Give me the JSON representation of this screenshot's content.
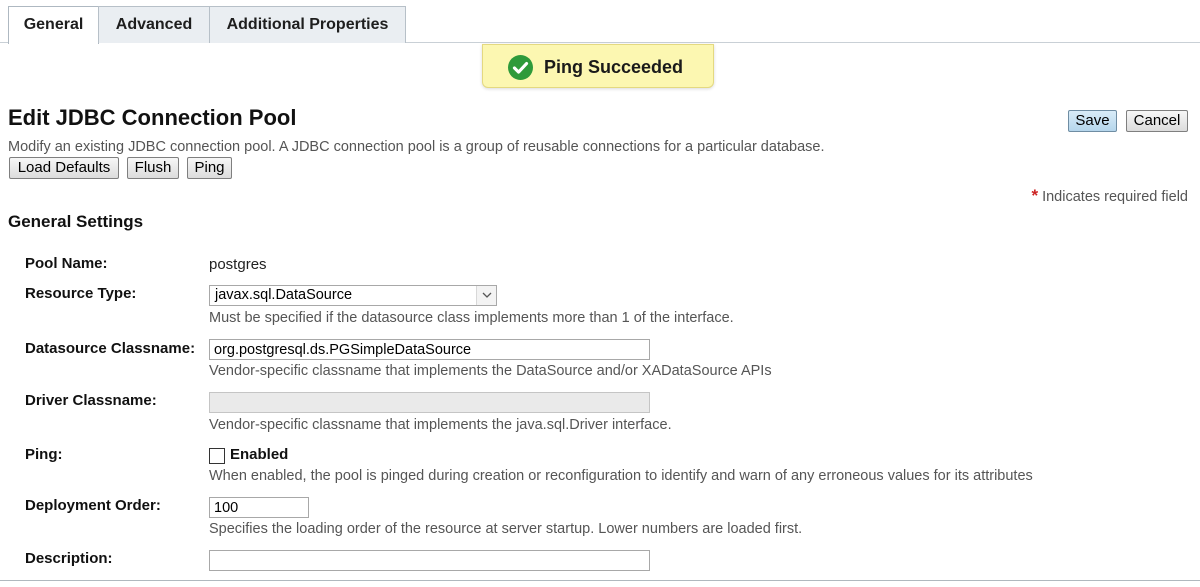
{
  "tabs": [
    {
      "label": "General"
    },
    {
      "label": "Advanced"
    },
    {
      "label": "Additional Properties"
    }
  ],
  "banner": {
    "message": "Ping Succeeded",
    "icon": "check-circle-icon",
    "color": "#2e9a3a"
  },
  "page": {
    "title": "Edit JDBC Connection Pool",
    "description": "Modify an existing JDBC connection pool. A JDBC connection pool is a group of reusable connections for a particular database."
  },
  "buttons": {
    "load_defaults": "Load Defaults",
    "flush": "Flush",
    "ping": "Ping",
    "save": "Save",
    "cancel": "Cancel"
  },
  "required_note": {
    "star": "*",
    "text": "Indicates required field"
  },
  "section": {
    "title": "General Settings"
  },
  "fields": {
    "pool_name": {
      "label": "Pool Name:",
      "value": "postgres"
    },
    "resource_type": {
      "label": "Resource Type:",
      "value": "javax.sql.DataSource",
      "help": "Must be specified if the datasource class implements more than 1 of the interface."
    },
    "datasource_classname": {
      "label": "Datasource Classname:",
      "value": "org.postgresql.ds.PGSimpleDataSource",
      "help": "Vendor-specific classname that implements the DataSource and/or XADataSource APIs"
    },
    "driver_classname": {
      "label": "Driver Classname:",
      "value": "",
      "help": "Vendor-specific classname that implements the java.sql.Driver interface."
    },
    "ping": {
      "label": "Ping:",
      "checkbox_label": "Enabled",
      "checked": false,
      "help": "When enabled, the pool is pinged during creation or reconfiguration to identify and warn of any erroneous values for its attributes"
    },
    "deployment_order": {
      "label": "Deployment Order:",
      "value": "100",
      "help": "Specifies the loading order of the resource at server startup. Lower numbers are loaded first."
    },
    "description": {
      "label": "Description:",
      "value": ""
    }
  }
}
